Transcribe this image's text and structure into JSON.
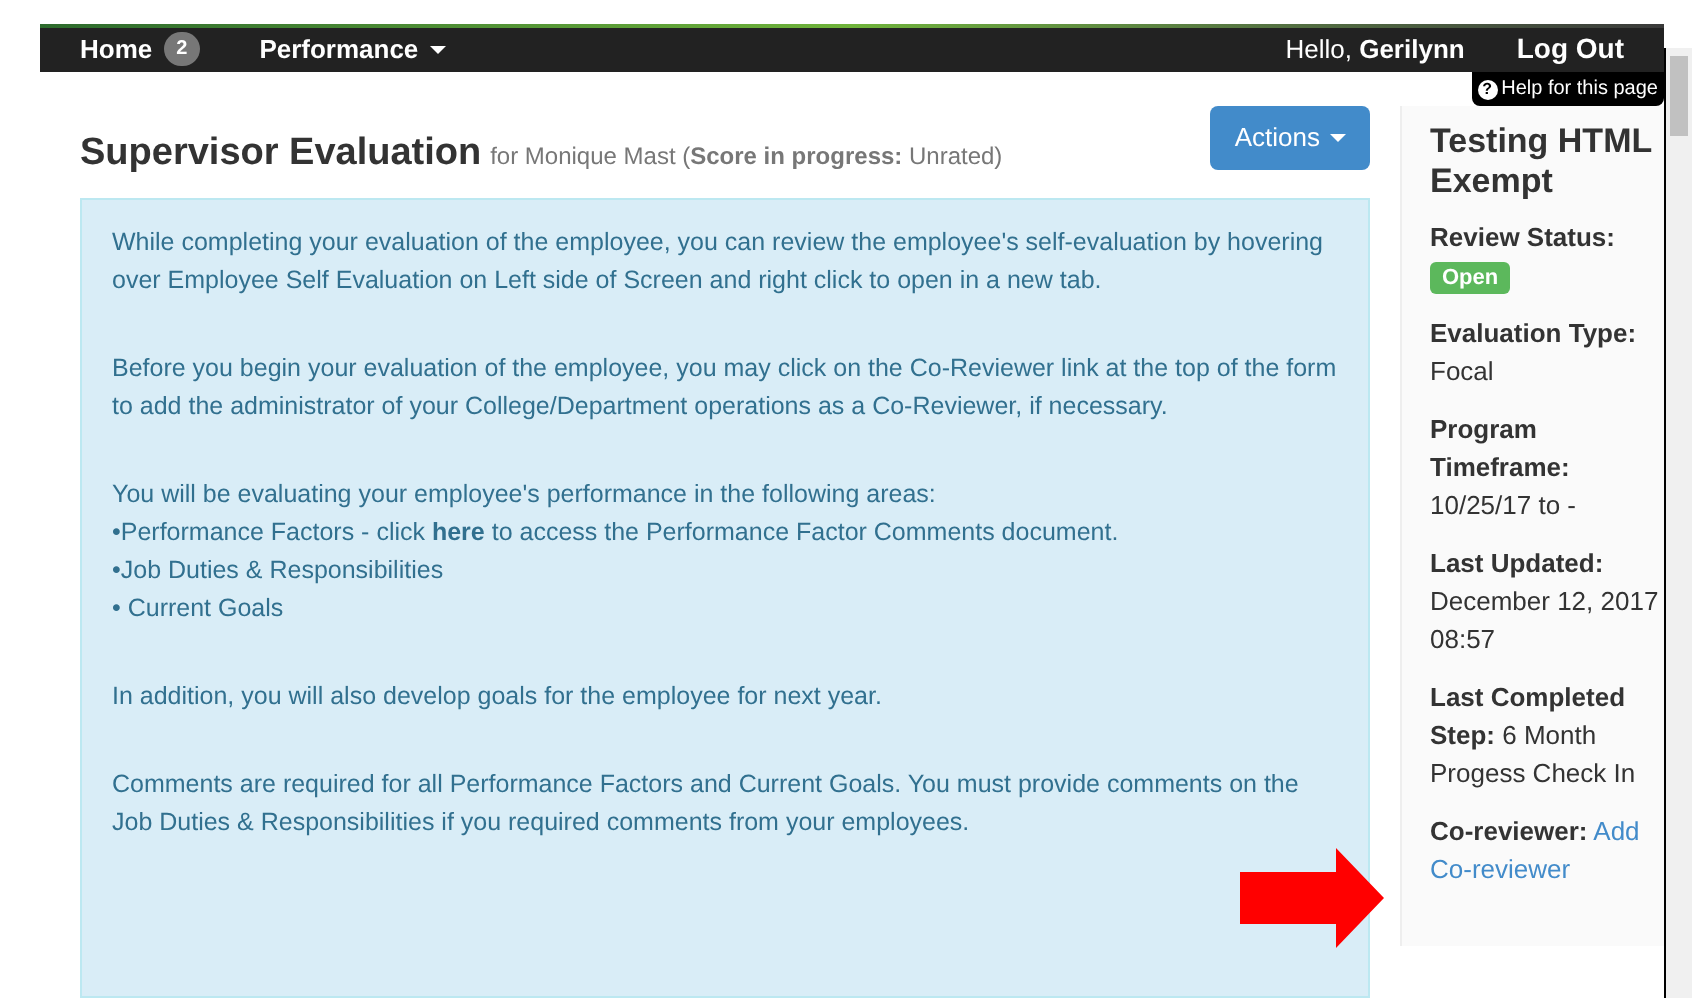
{
  "navbar": {
    "items": [
      {
        "label": "Home",
        "kind": "badge",
        "badge": "2"
      },
      {
        "label": "Performance",
        "kind": "dropdown"
      }
    ],
    "greeting": "Hello,",
    "user": "Gerilynn",
    "logout": "Log Out"
  },
  "help_icon": "?",
  "help_link": "Help for this page",
  "header": {
    "title": "Supervisor Evaluation",
    "subtitle": "for Monique Mast (**Score in progress:** Unrated)",
    "actions": "Actions"
  },
  "info": [
    {
      "kind": "paragraph",
      "lines": [
        "While completing your evaluation of the employee, you can review the employee's self-evaluation by hovering over Employee Self Evaluation on Left side of Screen and right click to open in a new tab."
      ]
    },
    {
      "kind": "paragraph",
      "lines": [
        "Before you begin your evaluation of the employee, you may click on the Co-Reviewer link at the top of the form to add the administrator of your College/Department operations as a Co-Reviewer, if necessary."
      ]
    },
    {
      "kind": "list",
      "intro": "You will be evaluating your employee's performance in the following areas:",
      "bullets": [
        {
          "text": "•Performance Factors - click ",
          "link": "here",
          "after": " to access the Performance Factor Comments document."
        },
        {
          "text": "•Job Duties & Responsibilities"
        },
        {
          "text": "• Current Goals"
        }
      ]
    },
    {
      "kind": "paragraph",
      "lines": [
        "In addition, you will also develop goals for the employee for next year."
      ]
    },
    {
      "kind": "paragraph",
      "lines": [
        "Comments are required for all Performance Factors and Current Goals. You must provide comments on the Job Duties & Responsibilities if you required comments from your employees."
      ]
    }
  ],
  "sidebar": {
    "title": "Testing HTML Exempt",
    "fields": [
      {
        "label": "Review Status:",
        "kind": "badge",
        "value": "Open"
      },
      {
        "label": "Evaluation Type:",
        "kind": "block",
        "value": "Focal"
      },
      {
        "label": "Program Timeframe:",
        "kind": "block",
        "value": "10/25/17 to -"
      },
      {
        "label": "Last Updated:",
        "kind": "block",
        "value": "December 12, 2017 08:57"
      },
      {
        "label": "Last Completed Step:",
        "kind": "inline",
        "value": "6 Month Progess Check In"
      },
      {
        "label": "Co-reviewer:",
        "kind": "link",
        "value": "Add Co-reviewer"
      }
    ]
  }
}
